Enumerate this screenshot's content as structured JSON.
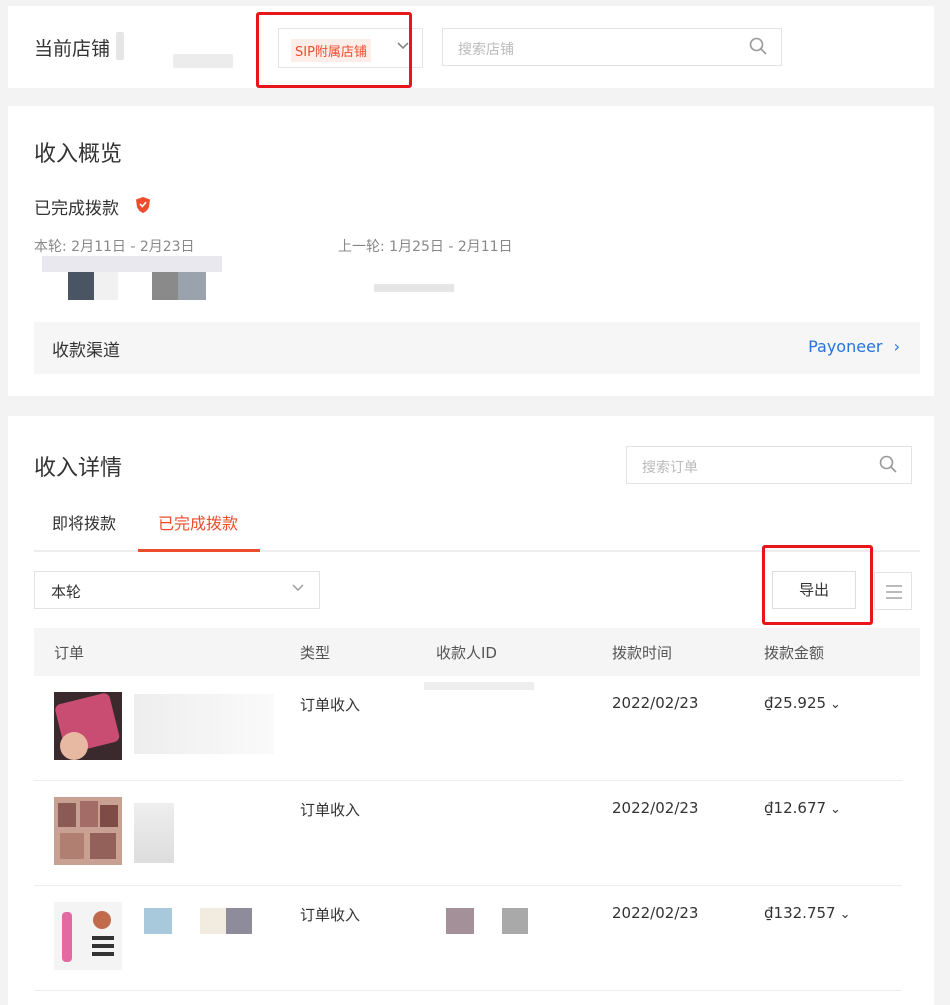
{
  "store_bar": {
    "label": "当前店铺",
    "store_select_value": "SIP附属店铺",
    "search_placeholder": "搜索店铺"
  },
  "overview": {
    "title": "收入概览",
    "completed_label": "已完成拨款",
    "current_period": "本轮: 2月11日 - 2月23日",
    "previous_period": "上一轮: 1月25日 - 2月11日",
    "channel_label": "收款渠道",
    "channel_value": "Payoneer",
    "channel_chevron": "›"
  },
  "details": {
    "title": "收入详情",
    "search_placeholder": "搜索订单",
    "tabs": [
      {
        "label": "即将拨款",
        "active": false
      },
      {
        "label": "已完成拨款",
        "active": true
      }
    ],
    "round_select_value": "本轮",
    "export_label": "导出",
    "columns": [
      "订单",
      "类型",
      "收款人ID",
      "拨款时间",
      "拨款金额"
    ],
    "rows": [
      {
        "type": "订单收入",
        "date": "2022/02/23",
        "amount": "₫25.925"
      },
      {
        "type": "订单收入",
        "date": "2022/02/23",
        "amount": "₫12.677"
      },
      {
        "type": "订单收入",
        "date": "2022/02/23",
        "amount": "₫132.757"
      }
    ]
  },
  "colors": {
    "accent": "#ee4d2d",
    "link": "#2673dd",
    "highlight_box": "#e8151b"
  },
  "icons": [
    "search-icon",
    "chevron-down-icon",
    "shield-icon",
    "chevron-right-icon",
    "list-menu-icon"
  ]
}
